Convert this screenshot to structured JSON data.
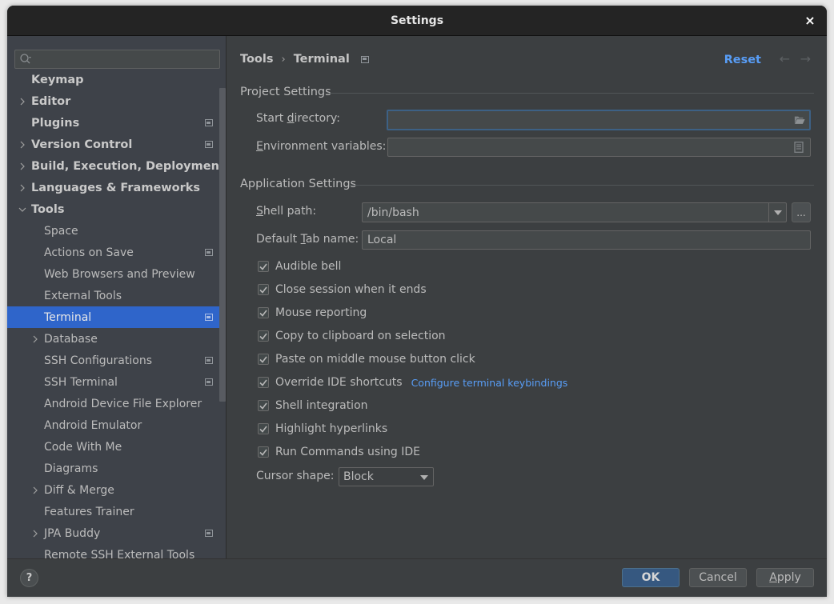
{
  "window": {
    "title": "Settings",
    "close_glyph": "×"
  },
  "search": {
    "placeholder": "",
    "value": ""
  },
  "sidebar": {
    "items": [
      {
        "label": "Keymap",
        "level": 0,
        "expand": "none",
        "project": false
      },
      {
        "label": "Editor",
        "level": 0,
        "expand": "collapsed",
        "project": false
      },
      {
        "label": "Plugins",
        "level": 0,
        "expand": "none",
        "project": true
      },
      {
        "label": "Version Control",
        "level": 0,
        "expand": "collapsed",
        "project": true
      },
      {
        "label": "Build, Execution, Deployment",
        "level": 0,
        "expand": "collapsed",
        "project": false
      },
      {
        "label": "Languages & Frameworks",
        "level": 0,
        "expand": "collapsed",
        "project": false
      },
      {
        "label": "Tools",
        "level": 0,
        "expand": "expanded",
        "project": false
      },
      {
        "label": "Space",
        "level": 1,
        "expand": "none",
        "project": false
      },
      {
        "label": "Actions on Save",
        "level": 1,
        "expand": "none",
        "project": true
      },
      {
        "label": "Web Browsers and Preview",
        "level": 1,
        "expand": "none",
        "project": false
      },
      {
        "label": "External Tools",
        "level": 1,
        "expand": "none",
        "project": false
      },
      {
        "label": "Terminal",
        "level": 1,
        "expand": "none",
        "project": true,
        "selected": true
      },
      {
        "label": "Database",
        "level": 1,
        "expand": "collapsed",
        "project": false
      },
      {
        "label": "SSH Configurations",
        "level": 1,
        "expand": "none",
        "project": true
      },
      {
        "label": "SSH Terminal",
        "level": 1,
        "expand": "none",
        "project": true
      },
      {
        "label": "Android Device File Explorer",
        "level": 1,
        "expand": "none",
        "project": false
      },
      {
        "label": "Android Emulator",
        "level": 1,
        "expand": "none",
        "project": false
      },
      {
        "label": "Code With Me",
        "level": 1,
        "expand": "none",
        "project": false
      },
      {
        "label": "Diagrams",
        "level": 1,
        "expand": "none",
        "project": false
      },
      {
        "label": "Diff & Merge",
        "level": 1,
        "expand": "collapsed",
        "project": false
      },
      {
        "label": "Features Trainer",
        "level": 1,
        "expand": "none",
        "project": false
      },
      {
        "label": "JPA Buddy",
        "level": 1,
        "expand": "collapsed",
        "project": true
      },
      {
        "label": "Remote SSH External Tools",
        "level": 1,
        "expand": "none",
        "project": false
      }
    ]
  },
  "header": {
    "breadcrumb_parent": "Tools",
    "breadcrumb_sep": "›",
    "breadcrumb_current": "Terminal",
    "reset_label": "Reset",
    "back_glyph": "←",
    "forward_glyph": "→"
  },
  "project_settings": {
    "title": "Project Settings",
    "start_directory": {
      "label_pre": "Start ",
      "label_mnemonic": "d",
      "label_post": "irectory:",
      "value": ""
    },
    "environment_variables": {
      "label_pre": "",
      "label_mnemonic": "E",
      "label_post": "nvironment variables:",
      "value": ""
    }
  },
  "application_settings": {
    "title": "Application Settings",
    "shell_path": {
      "label_pre": "",
      "label_mnemonic": "S",
      "label_post": "hell path:",
      "value": "/bin/bash",
      "browse_label": "..."
    },
    "default_tab_name": {
      "label_pre": "Default ",
      "label_mnemonic": "T",
      "label_post": "ab name:",
      "value": "Local"
    },
    "checkboxes": [
      {
        "label": "Audible bell",
        "checked": true
      },
      {
        "label": "Close session when it ends",
        "checked": true
      },
      {
        "label": "Mouse reporting",
        "checked": true
      },
      {
        "label": "Copy to clipboard on selection",
        "checked": true
      },
      {
        "label": "Paste on middle mouse button click",
        "checked": true
      },
      {
        "label": "Override IDE shortcuts",
        "checked": true,
        "link": "Configure terminal keybindings"
      },
      {
        "label": "Shell integration",
        "checked": true
      },
      {
        "label": "Highlight hyperlinks",
        "checked": true
      },
      {
        "label": "Run Commands using IDE",
        "checked": true
      }
    ],
    "cursor_shape": {
      "label": "Cursor shape:",
      "value": "Block"
    }
  },
  "footer": {
    "help_label": "?",
    "ok_label": "OK",
    "cancel_label": "Cancel",
    "apply_pre": "",
    "apply_mnemonic": "A",
    "apply_post": "pply"
  },
  "colors": {
    "accent": "#2f65ca",
    "link": "#589df6",
    "primary_button": "#365880"
  }
}
